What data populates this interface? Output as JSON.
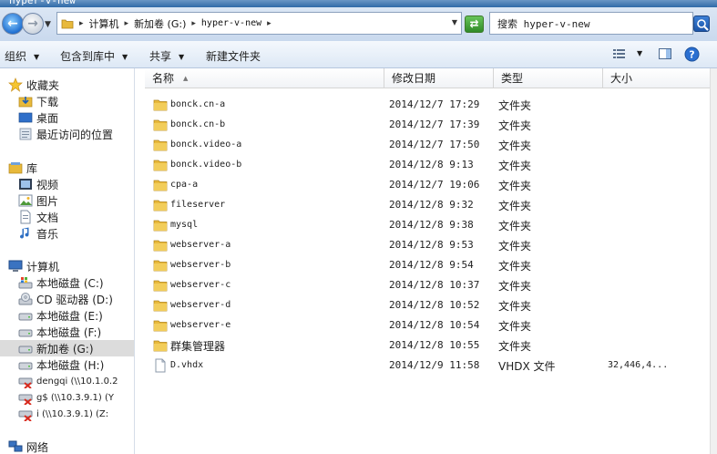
{
  "window": {
    "title": "hyper-v-new"
  },
  "address": {
    "crumbs": [
      {
        "label": "计算机",
        "mono": false
      },
      {
        "label": "新加卷 (G:)",
        "mono": false
      },
      {
        "label": "hyper-v-new",
        "mono": true
      }
    ]
  },
  "search": {
    "placeholder": "搜索 hyper-v-new"
  },
  "toolbar": {
    "organize": "组织",
    "include_library": "包含到库中",
    "share": "共享",
    "new_folder": "新建文件夹"
  },
  "sidebar": {
    "favorites": {
      "label": "收藏夹",
      "items": [
        "下载",
        "桌面",
        "最近访问的位置"
      ]
    },
    "libraries": {
      "label": "库",
      "items": [
        "视频",
        "图片",
        "文档",
        "音乐"
      ]
    },
    "computer": {
      "label": "计算机",
      "items": [
        {
          "label": "本地磁盘 (C:)",
          "icon": "local-disk-icon",
          "selected": false
        },
        {
          "label": "CD 驱动器 (D:)",
          "icon": "cd-drive-icon",
          "selected": false
        },
        {
          "label": "本地磁盘 (E:)",
          "icon": "drive-icon",
          "selected": false
        },
        {
          "label": "本地磁盘 (F:)",
          "icon": "drive-icon",
          "selected": false
        },
        {
          "label": "新加卷 (G:)",
          "icon": "drive-icon",
          "selected": true
        },
        {
          "label": "本地磁盘 (H:)",
          "icon": "drive-icon",
          "selected": false
        },
        {
          "label": "dengqi (\\\\10.1.0.2",
          "icon": "network-drive-disconnected-icon",
          "selected": false
        },
        {
          "label": "g$ (\\\\10.3.9.1) (Y",
          "icon": "network-drive-disconnected-icon",
          "selected": false
        },
        {
          "label": "i (\\\\10.3.9.1) (Z:",
          "icon": "network-drive-disconnected-icon",
          "selected": false
        }
      ]
    },
    "network": {
      "label": "网络"
    }
  },
  "columns": {
    "name": "名称",
    "date": "修改日期",
    "type": "类型",
    "size": "大小"
  },
  "files": [
    {
      "name": "bonck.cn-a",
      "date": "2014/12/7 17:29",
      "type": "文件夹",
      "size": "",
      "kind": "folder"
    },
    {
      "name": "bonck.cn-b",
      "date": "2014/12/7 17:39",
      "type": "文件夹",
      "size": "",
      "kind": "folder"
    },
    {
      "name": "bonck.video-a",
      "date": "2014/12/7 17:50",
      "type": "文件夹",
      "size": "",
      "kind": "folder"
    },
    {
      "name": "bonck.video-b",
      "date": "2014/12/8 9:13",
      "type": "文件夹",
      "size": "",
      "kind": "folder"
    },
    {
      "name": "cpa-a",
      "date": "2014/12/7 19:06",
      "type": "文件夹",
      "size": "",
      "kind": "folder"
    },
    {
      "name": "fileserver",
      "date": "2014/12/8 9:32",
      "type": "文件夹",
      "size": "",
      "kind": "folder"
    },
    {
      "name": "mysql",
      "date": "2014/12/8 9:38",
      "type": "文件夹",
      "size": "",
      "kind": "folder"
    },
    {
      "name": "webserver-a",
      "date": "2014/12/8 9:53",
      "type": "文件夹",
      "size": "",
      "kind": "folder"
    },
    {
      "name": "webserver-b",
      "date": "2014/12/8 9:54",
      "type": "文件夹",
      "size": "",
      "kind": "folder"
    },
    {
      "name": "webserver-c",
      "date": "2014/12/8 10:37",
      "type": "文件夹",
      "size": "",
      "kind": "folder"
    },
    {
      "name": "webserver-d",
      "date": "2014/12/8 10:52",
      "type": "文件夹",
      "size": "",
      "kind": "folder"
    },
    {
      "name": "webserver-e",
      "date": "2014/12/8 10:54",
      "type": "文件夹",
      "size": "",
      "kind": "folder"
    },
    {
      "name": "群集管理器",
      "date": "2014/12/8 10:55",
      "type": "文件夹",
      "size": "",
      "kind": "folder"
    },
    {
      "name": "D.vhdx",
      "date": "2014/12/9 11:58",
      "type": "VHDX 文件",
      "size": "32,446,4...",
      "kind": "file"
    }
  ]
}
